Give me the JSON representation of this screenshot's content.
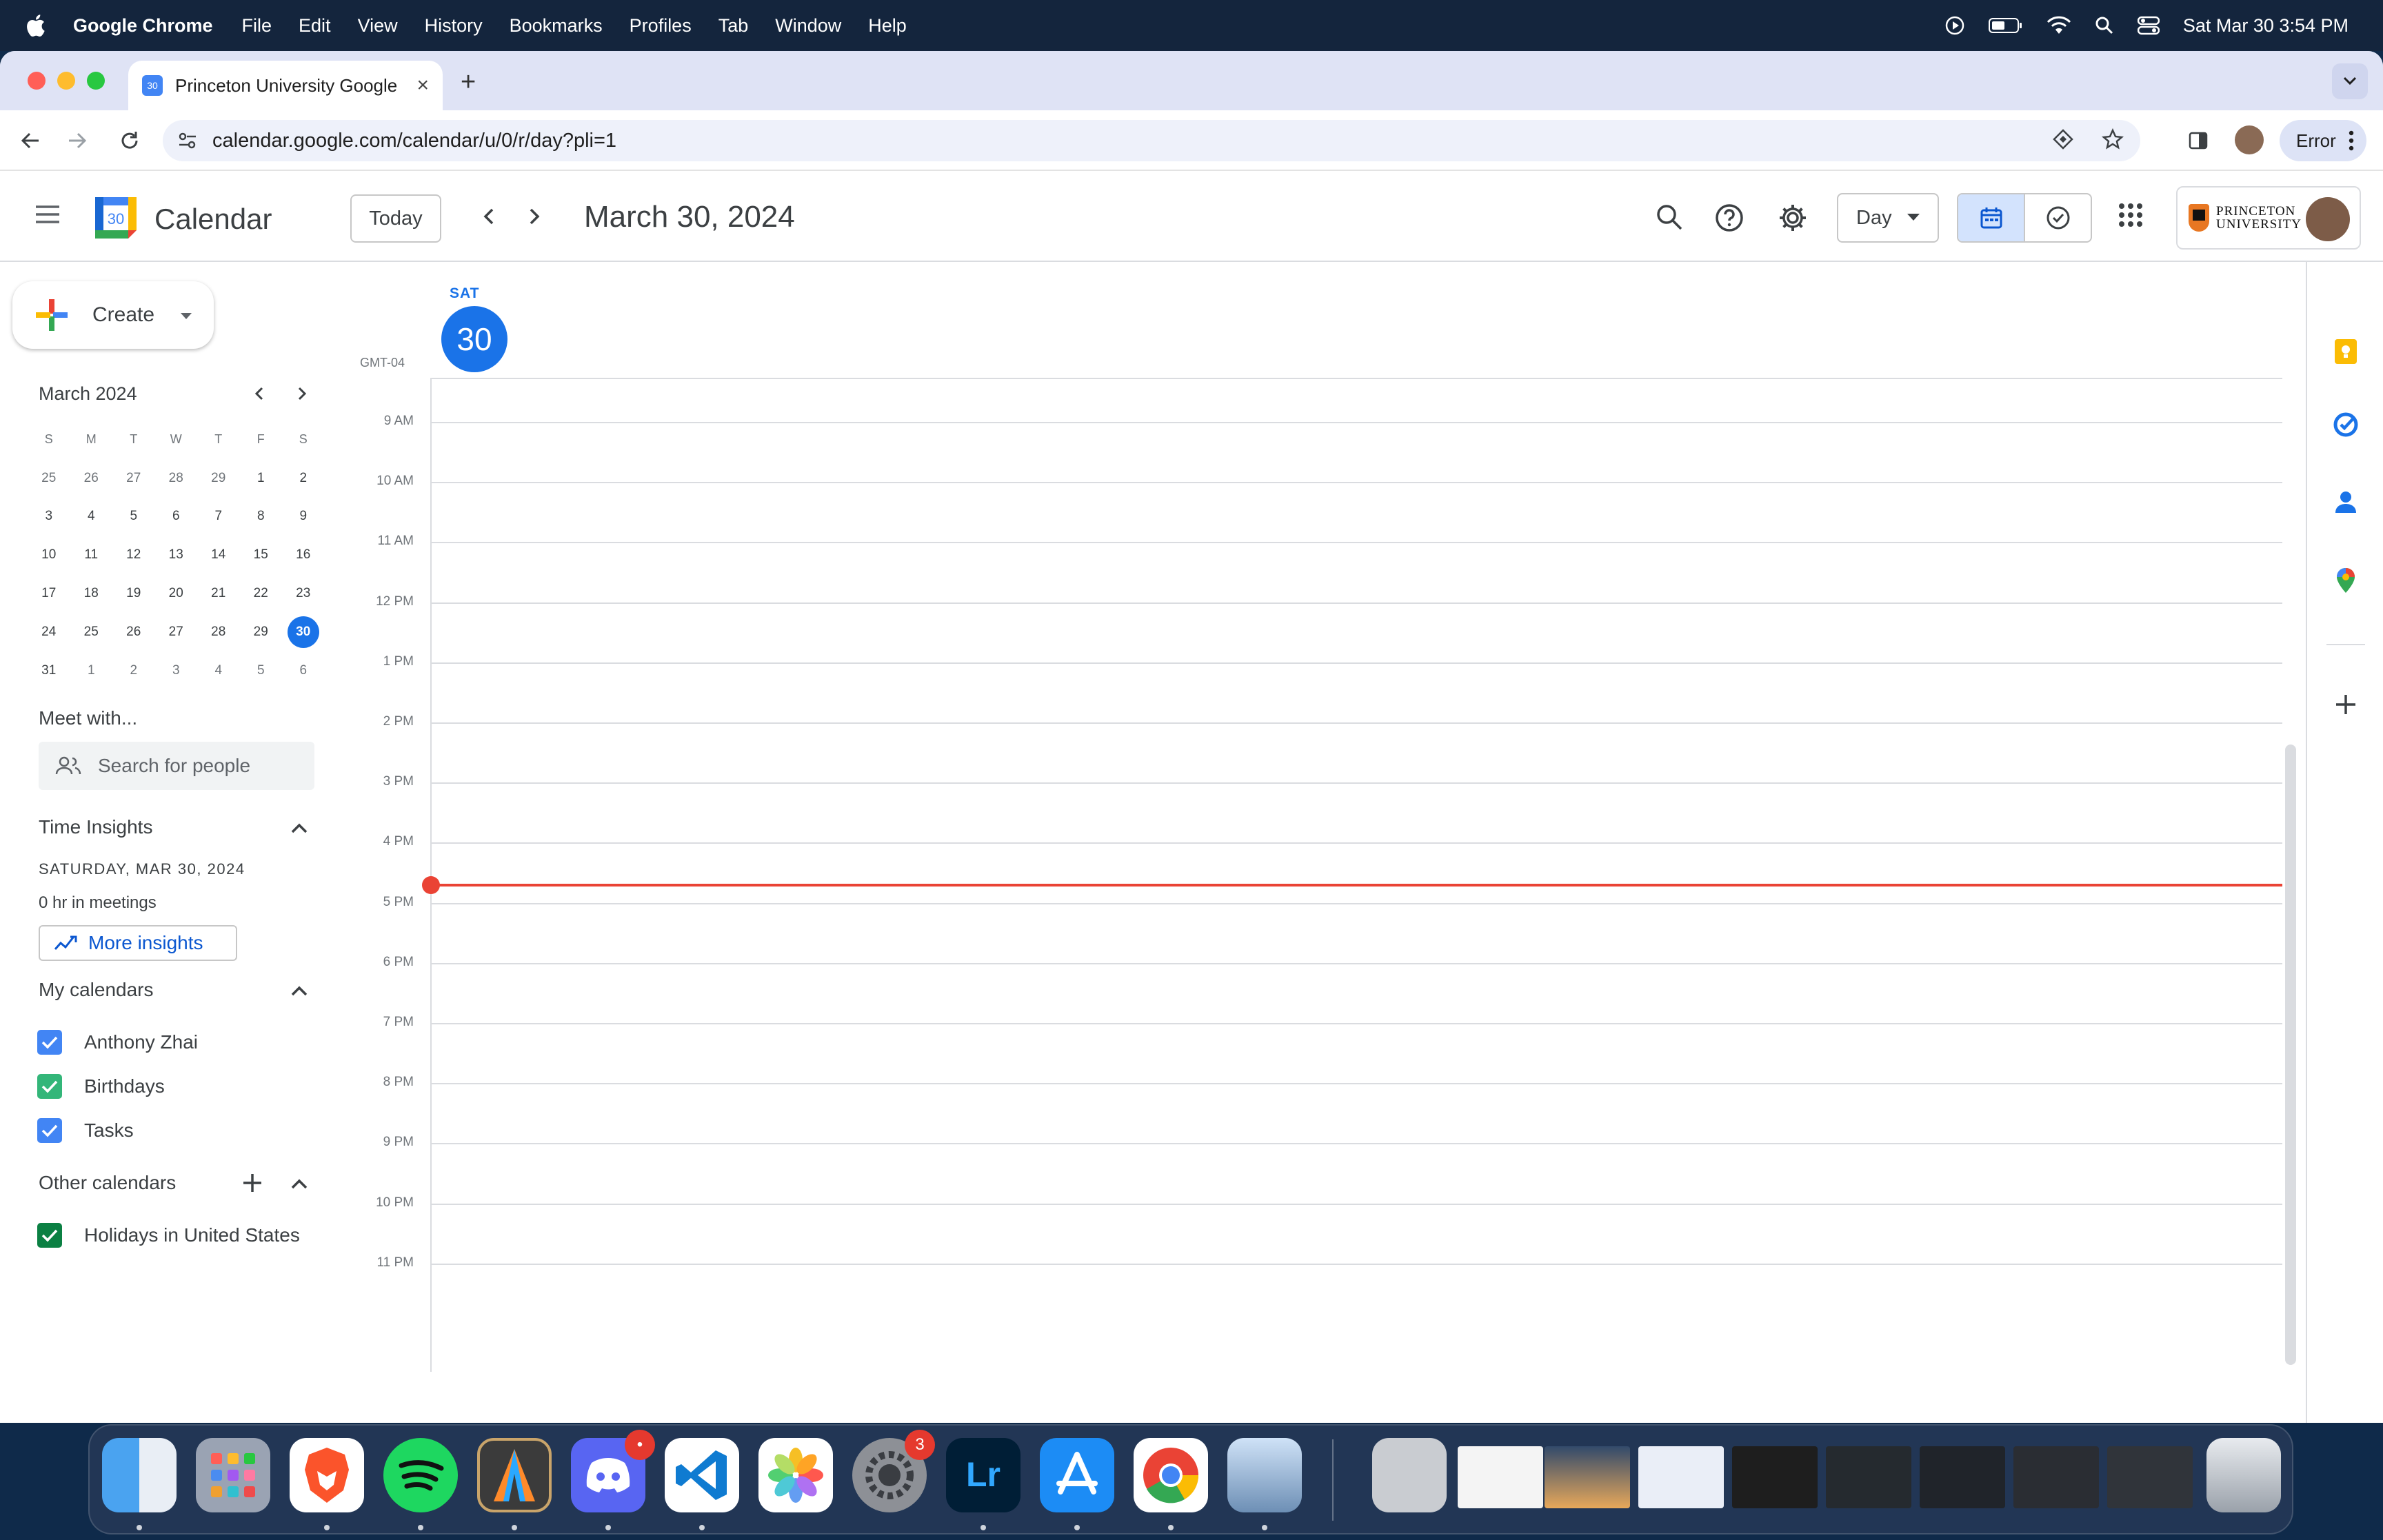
{
  "menubar": {
    "app_name": "Google Chrome",
    "items": [
      "File",
      "Edit",
      "View",
      "History",
      "Bookmarks",
      "Profiles",
      "Tab",
      "Window",
      "Help"
    ],
    "clock": "Sat Mar 30  3:54 PM"
  },
  "browser": {
    "tab_title": "Princeton University Google",
    "favicon_text": "30",
    "url": "calendar.google.com/calendar/u/0/r/day?pli=1",
    "profile_status": "Error"
  },
  "calendar": {
    "app_title": "Calendar",
    "logo_text": "30",
    "today_label": "Today",
    "date_title": "March 30, 2024",
    "view_label": "Day",
    "org_line1": "PRINCETON",
    "org_line2": "UNIVERSITY",
    "accent": "#1a73e8"
  },
  "sidebar": {
    "create_label": "Create",
    "mini_cal": {
      "month_label": "March 2024",
      "weekdays": [
        "S",
        "M",
        "T",
        "W",
        "T",
        "F",
        "S"
      ],
      "weeks": [
        [
          "25",
          "26",
          "27",
          "28",
          "29",
          "1",
          "2"
        ],
        [
          "3",
          "4",
          "5",
          "6",
          "7",
          "8",
          "9"
        ],
        [
          "10",
          "11",
          "12",
          "13",
          "14",
          "15",
          "16"
        ],
        [
          "17",
          "18",
          "19",
          "20",
          "21",
          "22",
          "23"
        ],
        [
          "24",
          "25",
          "26",
          "27",
          "28",
          "29",
          "30"
        ],
        [
          "31",
          "1",
          "2",
          "3",
          "4",
          "5",
          "6"
        ]
      ],
      "selected": "30"
    },
    "meet_with": {
      "title": "Meet with...",
      "search_placeholder": "Search for people"
    },
    "time_insights": {
      "title": "Time Insights",
      "date": "SATURDAY, MAR 30, 2024",
      "hours": "0 hr in meetings",
      "more_label": "More insights"
    },
    "my_calendars": {
      "title": "My calendars",
      "items": [
        {
          "label": "Anthony Zhai",
          "color": "#4285f4"
        },
        {
          "label": "Birthdays",
          "color": "#33b679"
        },
        {
          "label": "Tasks",
          "color": "#4285f4"
        }
      ]
    },
    "other_calendars": {
      "title": "Other calendars",
      "items": [
        {
          "label": "Holidays in United States",
          "color": "#0b8043"
        }
      ]
    }
  },
  "day_view": {
    "day_name": "SAT",
    "day_number": "30",
    "timezone": "GMT-04",
    "hours": [
      "9 AM",
      "10 AM",
      "11 AM",
      "12 PM",
      "1 PM",
      "2 PM",
      "3 PM",
      "4 PM",
      "5 PM",
      "6 PM",
      "7 PM",
      "8 PM",
      "9 PM",
      "10 PM",
      "11 PM"
    ],
    "now_indicator_color": "#ea4335"
  },
  "side_panel": {
    "icons": [
      "keep-icon",
      "tasks-icon",
      "contacts-icon",
      "maps-icon",
      "add-addon-icon",
      "expand-panel-icon"
    ]
  },
  "dock": {
    "apps": [
      "finder",
      "launchpad",
      "brave",
      "spotify",
      "affinity",
      "discord",
      "vscode",
      "photos",
      "system-settings",
      "lightroom",
      "app-store",
      "chrome",
      "preview"
    ],
    "badges": {
      "discord": "•",
      "system_settings": "3"
    }
  }
}
